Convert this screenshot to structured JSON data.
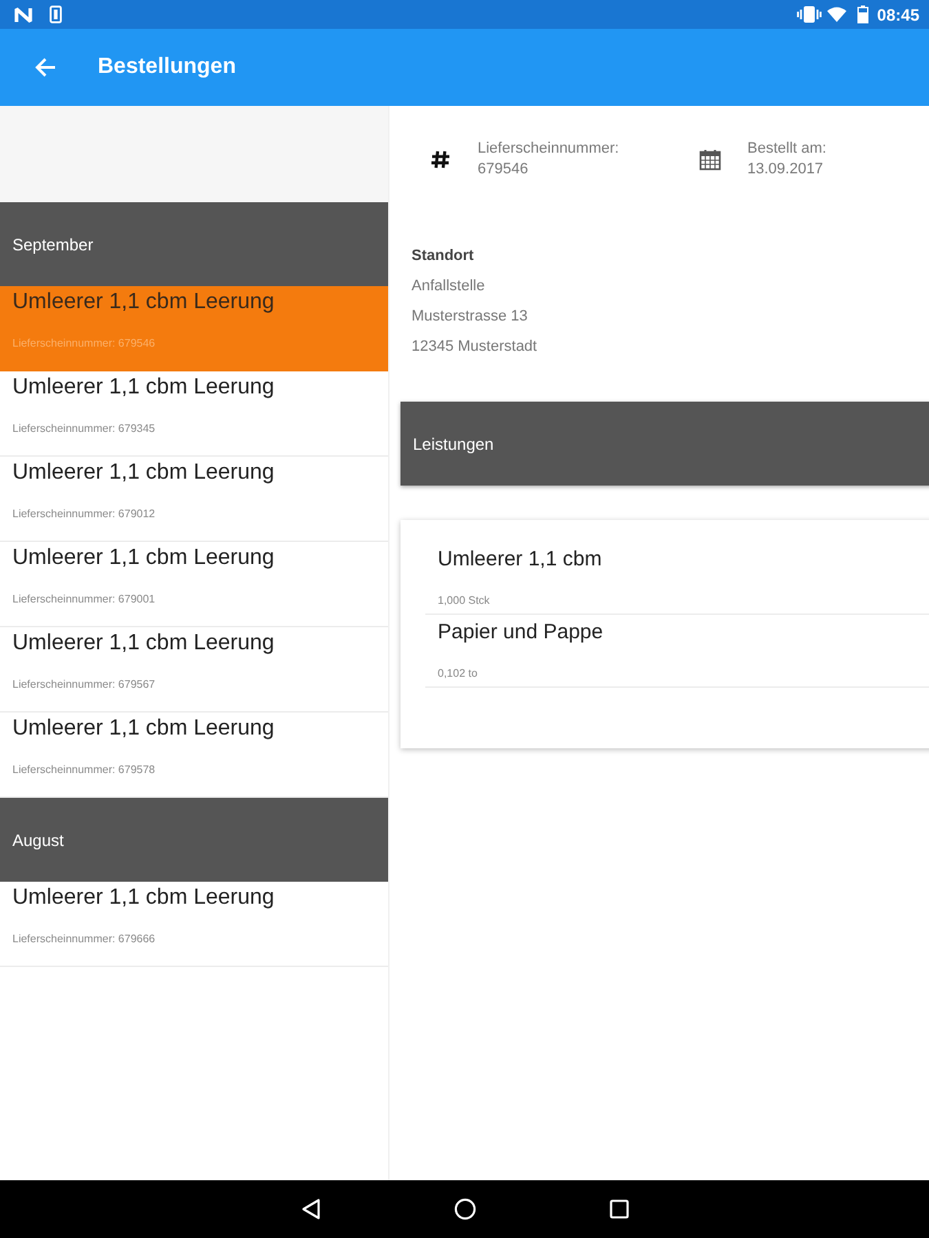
{
  "status_bar": {
    "time": "08:45"
  },
  "app_bar": {
    "title": "Bestellungen"
  },
  "orders": {
    "groups": [
      {
        "month": "September",
        "items": [
          {
            "title": "Umleerer 1,1 cbm Leerung",
            "subtitle": "Lieferscheinnummer: 679546",
            "selected": true
          },
          {
            "title": "Umleerer 1,1 cbm Leerung",
            "subtitle": "Lieferscheinnummer: 679345",
            "selected": false
          },
          {
            "title": "Umleerer 1,1 cbm Leerung",
            "subtitle": "Lieferscheinnummer: 679012",
            "selected": false
          },
          {
            "title": "Umleerer 1,1 cbm Leerung",
            "subtitle": "Lieferscheinnummer: 679001",
            "selected": false
          },
          {
            "title": "Umleerer 1,1 cbm Leerung",
            "subtitle": "Lieferscheinnummer: 679567",
            "selected": false
          },
          {
            "title": "Umleerer 1,1 cbm Leerung",
            "subtitle": "Lieferscheinnummer: 679578",
            "selected": false
          }
        ]
      },
      {
        "month": "August",
        "items": [
          {
            "title": "Umleerer 1,1 cbm Leerung",
            "subtitle": "Lieferscheinnummer: 679666",
            "selected": false
          }
        ]
      }
    ]
  },
  "detail": {
    "delivery_note": {
      "label": "Lieferscheinnummer:",
      "value": "679546"
    },
    "order_date": {
      "label": "Bestellt am:",
      "value": "13.09.2017"
    },
    "location": {
      "heading": "Standort",
      "lines": [
        "Anfallstelle",
        "Musterstrasse 13",
        "12345 Musterstadt"
      ]
    },
    "services": {
      "heading": "Leistungen",
      "items": [
        {
          "name": "Umleerer 1,1 cbm",
          "quantity": "1,000 Stck"
        },
        {
          "name": "Papier und Pappe",
          "quantity": "0,102 to"
        }
      ]
    }
  }
}
